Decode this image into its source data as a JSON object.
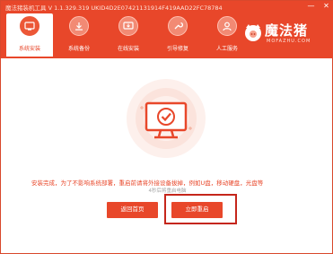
{
  "window": {
    "title": "魔法猪装机工具 V 1.1.329.319 UKID4D2E07421131914F419AAD22FC78784",
    "minimize_icon": "minimize-icon",
    "close_icon": "close-icon"
  },
  "nav": {
    "items": [
      {
        "label": "系统安装",
        "icon": "install-icon",
        "active": true
      },
      {
        "label": "系统备份",
        "icon": "backup-icon",
        "active": false
      },
      {
        "label": "在线安装",
        "icon": "online-install-icon",
        "active": false
      },
      {
        "label": "引导修复",
        "icon": "boot-repair-icon",
        "active": false
      },
      {
        "label": "人工服务",
        "icon": "support-icon",
        "active": false
      }
    ]
  },
  "logo": {
    "title": "魔法猪",
    "subtitle": "MOFAZHU.COM"
  },
  "main": {
    "illustration_icon": "monitor-check-icon",
    "message": "安装完成，为了不影响系统部署，重启前请将外接设备拔掉，例如U盘，移动硬盘，光盘等",
    "countdown": "4秒后将重启电脑",
    "home_button": "返回首页",
    "restart_button": "立即重启"
  },
  "colors": {
    "accent": "#e8472a",
    "highlight": "#c5261b"
  }
}
